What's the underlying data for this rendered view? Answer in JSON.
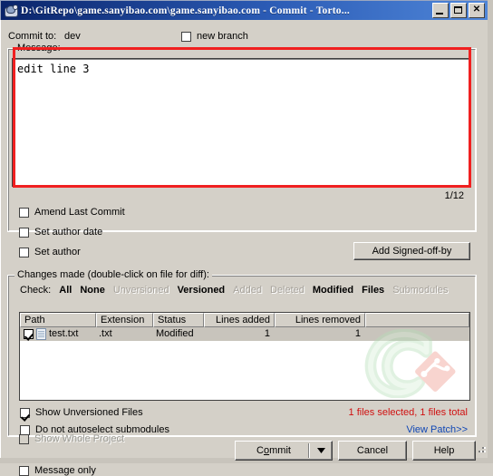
{
  "window": {
    "title": "D:\\GitRepo\\game.sanyibao.com\\game.sanyibao.com - Commit - Torto...",
    "minimize_label": "_",
    "maximize_label": "",
    "close_label": "✕"
  },
  "commit_to": {
    "label": "Commit to:",
    "value": "dev",
    "new_branch_label": "new branch",
    "new_branch_checked": false
  },
  "message": {
    "group_title": "Message:",
    "text": "edit line 3",
    "counter": "1/12"
  },
  "options": [
    {
      "label": "Amend Last Commit",
      "checked": false,
      "disabled": false
    },
    {
      "label": "Set author date",
      "checked": false,
      "disabled": false
    },
    {
      "label": "Set author",
      "checked": false,
      "disabled": false
    }
  ],
  "signed_off_button": "Add Signed-off-by",
  "changes": {
    "group_title": "Changes made (double-click on file for diff):",
    "check_label": "Check:",
    "check_links": [
      {
        "label": "All",
        "disabled": false
      },
      {
        "label": "None",
        "disabled": false
      },
      {
        "label": "Unversioned",
        "disabled": true
      },
      {
        "label": "Versioned",
        "disabled": false
      },
      {
        "label": "Added",
        "disabled": true
      },
      {
        "label": "Deleted",
        "disabled": true
      },
      {
        "label": "Modified",
        "disabled": false
      },
      {
        "label": "Files",
        "disabled": false
      },
      {
        "label": "Submodules",
        "disabled": true
      }
    ],
    "columns": [
      "Path",
      "Extension",
      "Status",
      "Lines added",
      "Lines removed",
      ""
    ],
    "rows": [
      {
        "checked": true,
        "path": "test.txt",
        "extension": ".txt",
        "status": "Modified",
        "lines_added": "1",
        "lines_removed": "1"
      }
    ],
    "show_unversioned": {
      "label": "Show Unversioned Files",
      "checked": true
    },
    "no_autoselect_submodules": {
      "label": "Do not autoselect submodules",
      "checked": false
    },
    "files_status": "1 files selected, 1 files total",
    "view_patch": "View Patch>>"
  },
  "footer": {
    "show_whole_project": {
      "label": "Show Whole Project",
      "checked": false,
      "disabled": true
    },
    "message_only": {
      "label": "Message only",
      "checked": false,
      "disabled": false
    },
    "commit_button": "Commit",
    "commit_accel_index": 1,
    "cancel_button": "Cancel",
    "help_button": "Help"
  },
  "colors": {
    "window_bg": "#d4d0c8",
    "title_bar": "#0a246a",
    "highlight_rect": "#f02020",
    "status_red": "#d01010",
    "link_blue": "#1047b5"
  }
}
